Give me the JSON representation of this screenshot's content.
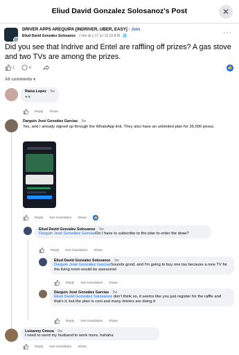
{
  "header": {
    "title": "Eliud David Gonzalez Solosanoz's Post",
    "close_icon": "close-icon"
  },
  "group": {
    "name": "DRIVER APPS AREQUIPA [INDRIVER, UBER, EASY]",
    "join_label": "Join",
    "author": "Eliud David Gonzalez Solosanoz",
    "meta": "· J she isl y  17 a t 12:10 A M ·"
  },
  "post": {
    "text": "Did you see that Indrive and Entel are raffling off prizes? A gas stove and two TVs are among the prizes.",
    "like_count": "1",
    "comment_count": "6"
  },
  "all_comments_label": "All comments",
  "comments": [
    {
      "name": "Raisa Lopez",
      "time": "· 3w",
      "text": "👀",
      "actions": [
        "Like",
        "Reply",
        "Share"
      ]
    },
    {
      "name": "Darguin José González Garcias",
      "time": "· 3w",
      "text": "Yes, and I already signed up through the WhatsApp link. They also have an unlimited plan for 35,000 pesos.",
      "actions": [
        "Like",
        "Reply",
        "See translation",
        "Share"
      ]
    },
    {
      "name": "Eliud David Gonzalez Solosanoz",
      "time": "· 3w",
      "mention": "Darguin José González Garcias",
      "text": "Do I have to subscribe to the plan to enter the draw?",
      "actions": [
        "Like",
        "Reply",
        "See translation",
        "Share"
      ]
    },
    {
      "name": "Eliud David Gonzalez Solosanoz",
      "time": "· 3w",
      "mention": "Darguin José González Garcias",
      "text": "Sounds good, and I'm going to buy one too because a new TV for the living room would be awesome!",
      "actions": [
        "Like",
        "Reply",
        "See translation",
        "Share"
      ]
    },
    {
      "name": "Darguin José González Garcias",
      "time": "· 3w",
      "mention": "Eliud David Gonzalez Solosanoz",
      "text": " don't think so, it seems like you just register for the raffle and that's it, but the plan is cool and many drivers are doing it",
      "actions": [
        "Like",
        "Reply",
        "See translation",
        "Share"
      ]
    },
    {
      "name": "Luisanny Cmeza",
      "time": "· 3w",
      "text": "I need to send my husband to work more, hahaha",
      "actions": [
        "Like",
        "Reply",
        "See translation",
        "Share"
      ]
    }
  ],
  "colors": {
    "accent": "#0866ff",
    "bubble": "#f0f2f5",
    "muted": "#65676b"
  }
}
